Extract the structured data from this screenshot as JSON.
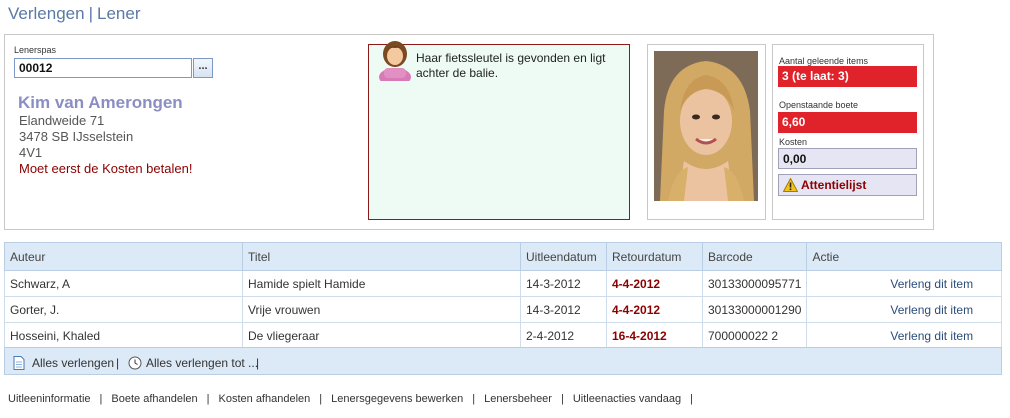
{
  "header": {
    "title_left": "Verlengen",
    "title_sep": "|",
    "title_right": "Lener"
  },
  "lenerspas": {
    "label": "Lenerspas",
    "value": "00012",
    "lookup_button": "..."
  },
  "borrower": {
    "name": "Kim van Amerongen",
    "street": "Elandweide 71",
    "city": "3478 SB  IJsselstein",
    "group": "4V1",
    "warning": "Moet eerst de Kosten betalen!"
  },
  "message": {
    "text": "Haar fietssleutel is gevonden en ligt achter de balie."
  },
  "stats": {
    "items_label": "Aantal geleende items",
    "items_value": "3  (te laat: 3)",
    "fine_label": "Openstaande boete",
    "fine_value": "6,60",
    "costs_label": "Kosten",
    "costs_value": "0,00",
    "attention_label": "Attentielijst"
  },
  "table": {
    "headers": [
      "Auteur",
      "Titel",
      "Uitleendatum",
      "Retourdatum",
      "Barcode",
      "Actie"
    ],
    "rows": [
      {
        "auteur": "Schwarz, A",
        "titel": "Hamide spielt Hamide",
        "uitleen": "14-3-2012",
        "retour": "4-4-2012",
        "barcode": "30133000095771",
        "actie": "Verleng dit item"
      },
      {
        "auteur": "Gorter, J.",
        "titel": "Vrije vrouwen",
        "uitleen": "14-3-2012",
        "retour": "4-4-2012",
        "barcode": "30133000001290",
        "actie": "Verleng dit item"
      },
      {
        "auteur": "Hosseini, Khaled",
        "titel": "De vliegeraar",
        "uitleen": "2-4-2012",
        "retour": "16-4-2012",
        "barcode": "700000022 2",
        "actie": "Verleng dit item"
      }
    ]
  },
  "table_footer": {
    "renew_all": "Alles verlengen",
    "renew_all_until": "Alles verlengen tot ...",
    "sep": "|"
  },
  "bottom_links": [
    "Uitleeninformatie",
    "Boete afhandelen",
    "Kosten afhandelen",
    "Lenersgegevens bewerken",
    "Lenersbeheer",
    "Uitleenacties vandaag"
  ],
  "colors": {
    "accent": "#5b79a6",
    "alert_red": "#e0222a",
    "dark_red": "#8b0000",
    "header_blue": "#dce9f7"
  }
}
